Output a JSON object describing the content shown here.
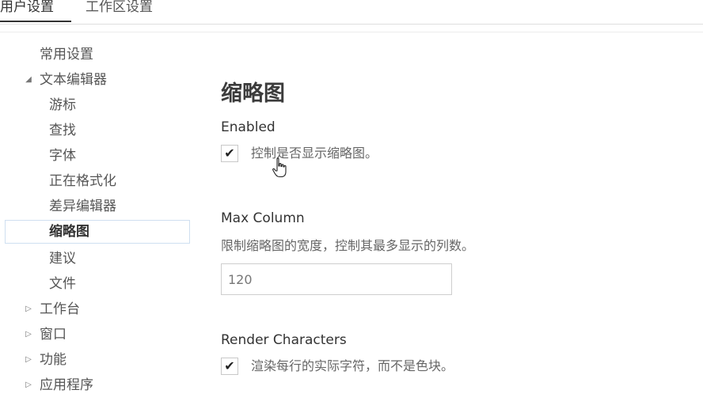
{
  "tabs": {
    "user": "用户设置",
    "workspace": "工作区设置"
  },
  "sidebar": {
    "items": [
      {
        "label": "常用设置"
      },
      {
        "label": "文本编辑器",
        "arrow": "◢"
      },
      {
        "label": "游标"
      },
      {
        "label": "查找"
      },
      {
        "label": "字体"
      },
      {
        "label": "正在格式化"
      },
      {
        "label": "差异编辑器"
      },
      {
        "label": "缩略图"
      },
      {
        "label": "建议"
      },
      {
        "label": "文件"
      },
      {
        "label": "工作台",
        "arrow": "▷"
      },
      {
        "label": "窗口",
        "arrow": "▷"
      },
      {
        "label": "功能",
        "arrow": "▷"
      },
      {
        "label": "应用程序",
        "arrow": "▷"
      }
    ]
  },
  "main": {
    "title": "缩略图",
    "enabled": {
      "name": "Enabled",
      "checkbox": "✔",
      "description": "控制是否显示缩略图。"
    },
    "max_column": {
      "name": "Max Column",
      "description": "限制缩略图的宽度，控制其最多显示的列数。",
      "value": "120"
    },
    "render_characters": {
      "name": "Render Characters",
      "checkbox": "✔",
      "description": "渲染每行的实际字符，而不是色块。"
    }
  }
}
